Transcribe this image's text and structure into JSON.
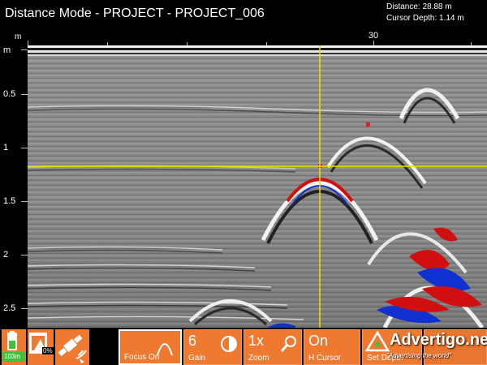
{
  "app": {
    "title": "Distance Mode - PROJECT - PROJECT_006"
  },
  "readouts": {
    "distance": "Distance: 28.88 m",
    "cursor_depth": "Cursor Depth: 1.14 m"
  },
  "ruler": {
    "h_unit": "m",
    "h_tick_label": "30",
    "v_unit": "m",
    "v_labels": [
      "0.5",
      "1",
      "1.5",
      "2",
      "2.5"
    ]
  },
  "status": {
    "battery_label": "103m",
    "storage_label": "0%",
    "gps_icon": "satellite-icon"
  },
  "toolbar": {
    "focus": {
      "value": "",
      "label": "Focus On"
    },
    "gain": {
      "value": "6",
      "label": "Gain"
    },
    "zoom": {
      "value": "1x",
      "label": "Zoom"
    },
    "hcursor": {
      "value": "On",
      "label": "H Cursor"
    },
    "setdepth": {
      "value": "",
      "label": "Set Depth"
    }
  },
  "watermark": {
    "brand": "Advertigo.net",
    "slogan": "\"Advertising the world\""
  },
  "colors": {
    "accent": "#ee7a31",
    "cursor": "#f0e000",
    "hyperbola_red": "#d01010",
    "hyperbola_blue": "#1030d0"
  }
}
